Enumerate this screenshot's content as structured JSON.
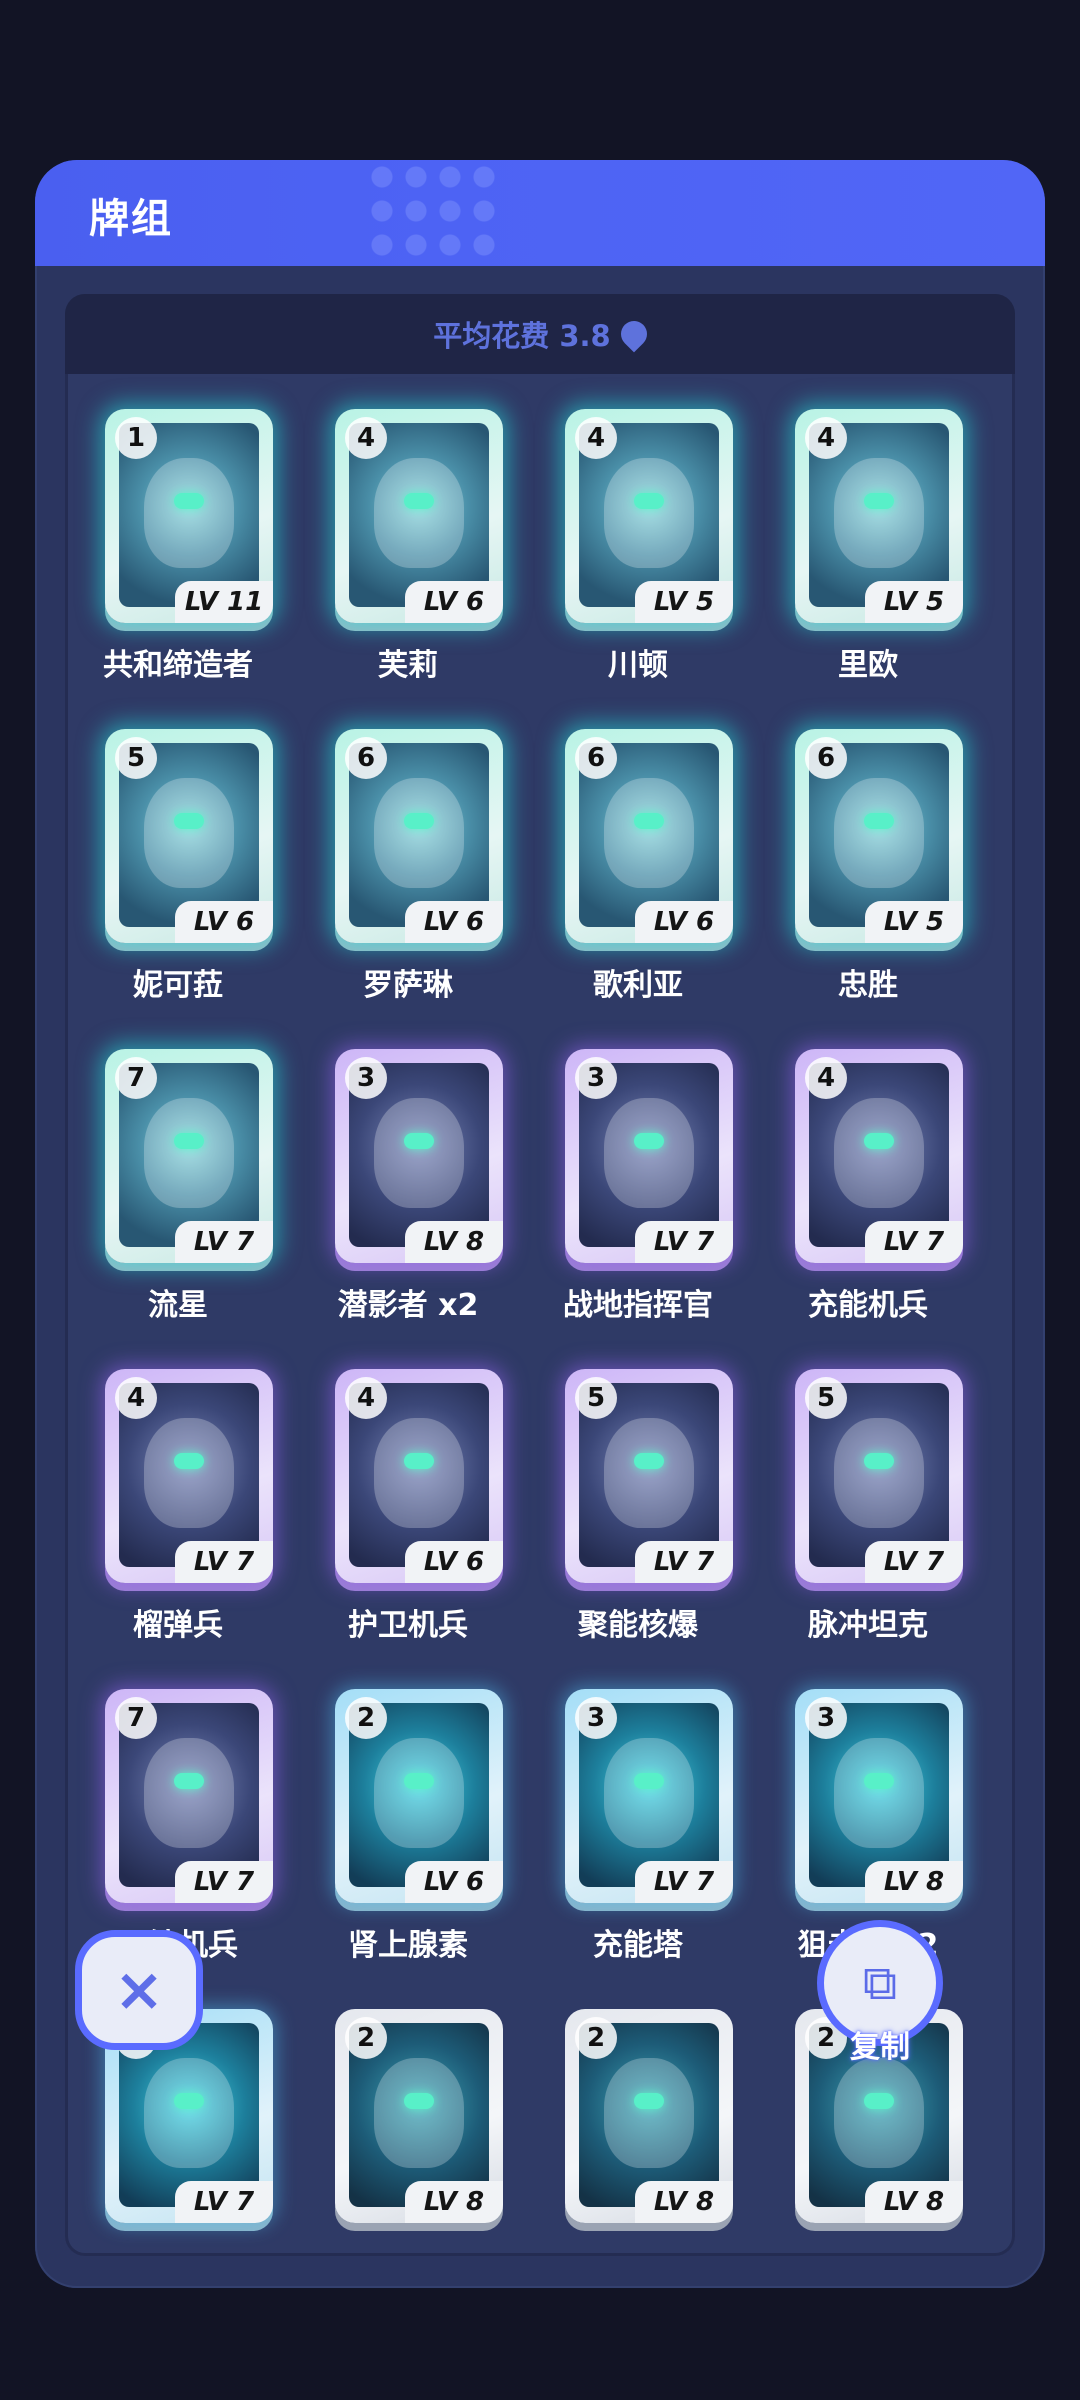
{
  "header": {
    "title": "牌组"
  },
  "deck": {
    "avg_cost_label": "平均花费 3.8"
  },
  "cards": [
    {
      "cost": "1",
      "level": "LV 11",
      "name": "共和缔造者",
      "rarity": "teal"
    },
    {
      "cost": "4",
      "level": "LV 6",
      "name": "芙莉",
      "rarity": "teal"
    },
    {
      "cost": "4",
      "level": "LV 5",
      "name": "川顿",
      "rarity": "teal"
    },
    {
      "cost": "4",
      "level": "LV 5",
      "name": "里欧",
      "rarity": "teal"
    },
    {
      "cost": "5",
      "level": "LV 6",
      "name": "妮可菈",
      "rarity": "teal"
    },
    {
      "cost": "6",
      "level": "LV 6",
      "name": "罗萨琳",
      "rarity": "teal"
    },
    {
      "cost": "6",
      "level": "LV 6",
      "name": "歌利亚",
      "rarity": "teal"
    },
    {
      "cost": "6",
      "level": "LV 5",
      "name": "忠胜",
      "rarity": "teal"
    },
    {
      "cost": "7",
      "level": "LV 7",
      "name": "流星",
      "rarity": "teal"
    },
    {
      "cost": "3",
      "level": "LV 8",
      "name": "潜影者 x2",
      "rarity": "purple"
    },
    {
      "cost": "3",
      "level": "LV 7",
      "name": "战地指挥官",
      "rarity": "purple"
    },
    {
      "cost": "4",
      "level": "LV 7",
      "name": "充能机兵",
      "rarity": "purple"
    },
    {
      "cost": "4",
      "level": "LV 7",
      "name": "榴弹兵",
      "rarity": "purple"
    },
    {
      "cost": "4",
      "level": "LV 6",
      "name": "护卫机兵",
      "rarity": "purple"
    },
    {
      "cost": "5",
      "level": "LV 7",
      "name": "聚能核爆",
      "rarity": "purple"
    },
    {
      "cost": "5",
      "level": "LV 7",
      "name": "脉冲坦克",
      "rarity": "purple"
    },
    {
      "cost": "7",
      "level": "LV 7",
      "name": "巨钻机兵",
      "rarity": "purple"
    },
    {
      "cost": "2",
      "level": "LV 6",
      "name": "肾上腺素",
      "rarity": "blue"
    },
    {
      "cost": "3",
      "level": "LV 7",
      "name": "充能塔",
      "rarity": "blue"
    },
    {
      "cost": "3",
      "level": "LV 8",
      "name": "狙击手 x2",
      "rarity": "blue"
    },
    {
      "cost": "3",
      "level": "LV 7",
      "name": "",
      "rarity": "blue"
    },
    {
      "cost": "2",
      "level": "LV 8",
      "name": "",
      "rarity": "white"
    },
    {
      "cost": "2",
      "level": "LV 8",
      "name": "",
      "rarity": "white"
    },
    {
      "cost": "2",
      "level": "LV 8",
      "name": "",
      "rarity": "white"
    }
  ],
  "actions": {
    "close_icon": "×",
    "copy_label": "复制",
    "copy_icon": "copy-icon"
  },
  "colors": {
    "accent": "#4d63f4",
    "teal_glow": "#26dedc",
    "purple_glow": "#9664f0"
  }
}
